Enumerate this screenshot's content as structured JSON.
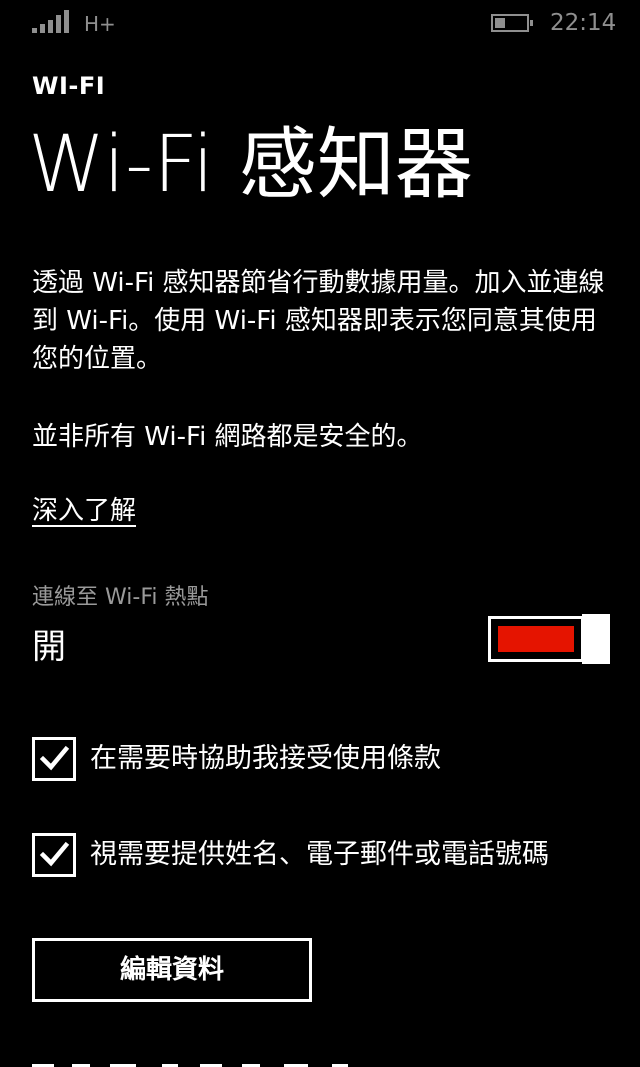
{
  "status_bar": {
    "network_type": "H+",
    "time": "22:14",
    "signal_icon": "signal-strength-icon",
    "battery_icon": "battery-icon"
  },
  "header": {
    "app_title": "WI-FI",
    "page_title": "Wi-Fi 感知器"
  },
  "content": {
    "description": "透過 Wi-Fi 感知器節省行動數據用量。加入並連線到 Wi-Fi。使用 Wi-Fi 感知器即表示您同意其使用您的位置。",
    "warning": "並非所有 Wi-Fi 網路都是安全的。",
    "learn_more": "深入了解"
  },
  "hotspot_toggle": {
    "label": "連線至 Wi-Fi 熱點",
    "state": "開",
    "on": true,
    "accent_color": "#e51400"
  },
  "checkboxes": [
    {
      "label": "在需要時協助我接受使用條款",
      "checked": true
    },
    {
      "label": "視需要提供姓名、電子郵件或電話號碼",
      "checked": true
    }
  ],
  "edit_button": {
    "label": "編輯資料"
  },
  "colors": {
    "background": "#000000",
    "foreground": "#ffffff",
    "secondary_text": "#9a9a9a",
    "accent": "#e51400"
  }
}
